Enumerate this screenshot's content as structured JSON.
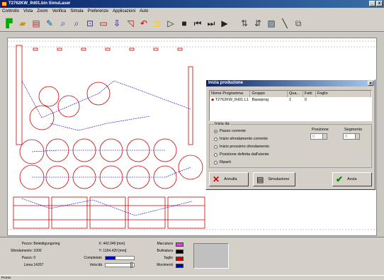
{
  "window": {
    "title": "T2762KW_lht01.bin SimuLaser",
    "minimize": "_",
    "close": "x"
  },
  "menu": [
    "Controllo",
    "Vista",
    "Zoom",
    "Verifica",
    "Simula",
    "Preferenze",
    "Applicazioni",
    "Auto"
  ],
  "toolbar": {
    "icons": [
      "tool-setup-icon",
      "open-folder-icon",
      "sheet-icon",
      "edit-parts-icon",
      "zoom-in-icon",
      "zoom-out-icon",
      "zoom-window-icon",
      "step-cut-icon",
      "step-down-icon",
      "rapid-move-icon",
      "arc-move-icon",
      "repeat-icon",
      "play-icon",
      "stop-icon",
      "go-start-icon",
      "step-back-icon",
      "step-forward-icon",
      "sort-icon",
      "priority-icon",
      "drawing-icon",
      "line-icon",
      "report-icon"
    ]
  },
  "dialog": {
    "title": "Inizia produzione",
    "close": "x",
    "columns": [
      "Nome Programma",
      "Gruppo",
      "Qua...",
      "Fatti",
      "Foglio"
    ],
    "rows": [
      {
        "name": "T2762KW_lht01.L1",
        "group": "Baseprog",
        "qty": "1",
        "done": "0",
        "sheet": ""
      }
    ],
    "start_from_label": "Inizia da:",
    "options": [
      {
        "label": "Passo corrente",
        "selected": true
      },
      {
        "label": "Inizio sfondamento corrente",
        "selected": false
      },
      {
        "label": "Inizio prossimo sfondamento",
        "selected": false
      },
      {
        "label": "Posizione definita dall'utente",
        "selected": false
      },
      {
        "label": "Riparti",
        "selected": false
      }
    ],
    "position_label": "Posizione",
    "position_value": "0",
    "segment_label": "Segmento",
    "segment_value": "0",
    "cancel_label": "Annulla",
    "simulate_label": "Simulazione",
    "start_label": "Avvia"
  },
  "status": {
    "piece_label": "Pezzo:",
    "piece_value": "Beleidigungsring",
    "pierce_label": "Sfondamento:",
    "pierce_value": "1000",
    "step_label": "Passo:",
    "step_value": "0",
    "line_label": "Linea",
    "line_value": "14207",
    "x_label": "X:",
    "x_value": "442.049 [mm]",
    "y_label": "Y:",
    "y_value": "1164.420 [mm]",
    "completed_label": "Completato",
    "completed_fraction": 0.35,
    "speed_label": "Velocità",
    "marking_label": "Marcatura",
    "marking_color": "#e040e0",
    "burning_label": "Bulinatura",
    "burning_color": "#000000",
    "cut_label": "Taglio",
    "cut_color": "#e00000",
    "move_label": "Movimenti",
    "move_color": "#0000c0",
    "bar": "Pronto"
  }
}
